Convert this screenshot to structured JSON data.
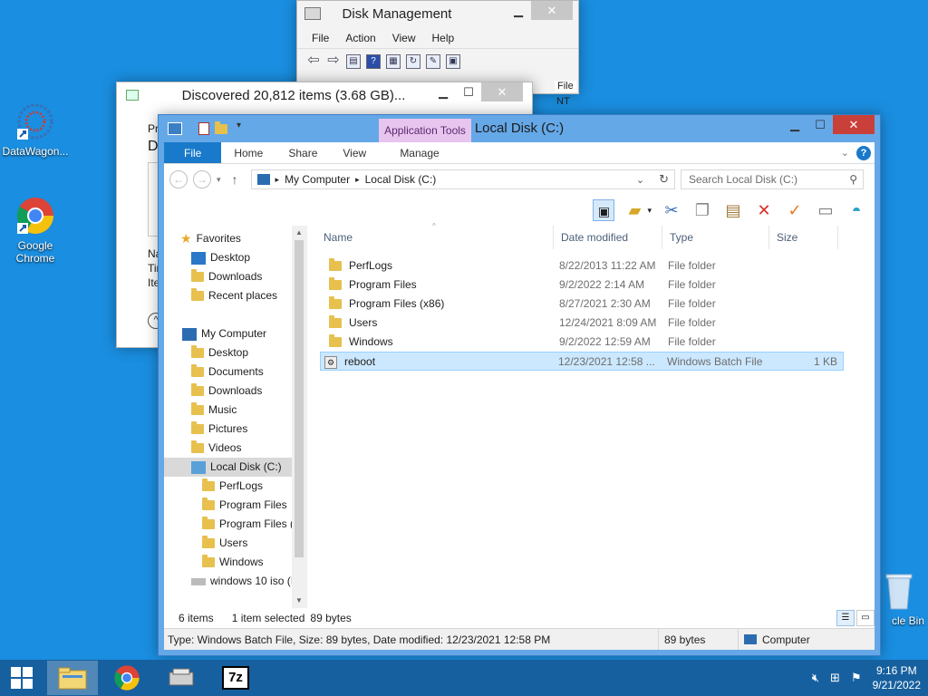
{
  "desktop": {
    "icons": [
      {
        "label": "DataWagon..."
      },
      {
        "label": "Google Chrome"
      },
      {
        "label": "cle Bin"
      }
    ]
  },
  "disk_mgmt": {
    "title": "Disk Management",
    "menu": [
      "File",
      "Action",
      "View",
      "Help"
    ],
    "col_header": "File",
    "col_value": "NT"
  },
  "discovered": {
    "title": "Discovered 20,812 items (3.68 GB)...",
    "labels": [
      "Pr",
      "D",
      "Na",
      "Tir",
      "Ite"
    ]
  },
  "explorer": {
    "title": "Local Disk (C:)",
    "context_tab": "Application Tools",
    "tabs": [
      "File",
      "Home",
      "Share",
      "View",
      "Manage"
    ],
    "address": [
      "My Computer",
      "Local Disk (C:)"
    ],
    "search_placeholder": "Search Local Disk (C:)",
    "nav": {
      "favorites": "Favorites",
      "fav_items": [
        "Desktop",
        "Downloads",
        "Recent places"
      ],
      "computer": "My Computer",
      "comp_items": [
        "Desktop",
        "Documents",
        "Downloads",
        "Music",
        "Pictures",
        "Videos"
      ],
      "local_disk": "Local Disk (C:)",
      "disk_items": [
        "PerfLogs",
        "Program Files",
        "Program Files (",
        "Users",
        "Windows"
      ],
      "iso": "windows 10 iso (I"
    },
    "columns": {
      "name": "Name",
      "date": "Date modified",
      "type": "Type",
      "size": "Size"
    },
    "files": [
      {
        "name": "PerfLogs",
        "date": "8/22/2013 11:22 AM",
        "type": "File folder",
        "size": ""
      },
      {
        "name": "Program Files",
        "date": "9/2/2022 2:14 AM",
        "type": "File folder",
        "size": ""
      },
      {
        "name": "Program Files (x86)",
        "date": "8/27/2021 2:30 AM",
        "type": "File folder",
        "size": ""
      },
      {
        "name": "Users",
        "date": "12/24/2021 8:09 AM",
        "type": "File folder",
        "size": ""
      },
      {
        "name": "Windows",
        "date": "9/2/2022 12:59 AM",
        "type": "File folder",
        "size": ""
      },
      {
        "name": "reboot",
        "date": "12/23/2021 12:58 ...",
        "type": "Windows Batch File",
        "size": "1 KB"
      }
    ],
    "status": {
      "count": "6 items",
      "selected": "1 item selected",
      "size": "89 bytes"
    },
    "details": {
      "text": "Type: Windows Batch File, Size: 89 bytes, Date modified: 12/23/2021 12:58 PM",
      "size": "89 bytes",
      "location": "Computer"
    }
  },
  "taskbar": {
    "time": "9:16 PM",
    "date": "9/21/2022",
    "seven_zip": "7z"
  }
}
